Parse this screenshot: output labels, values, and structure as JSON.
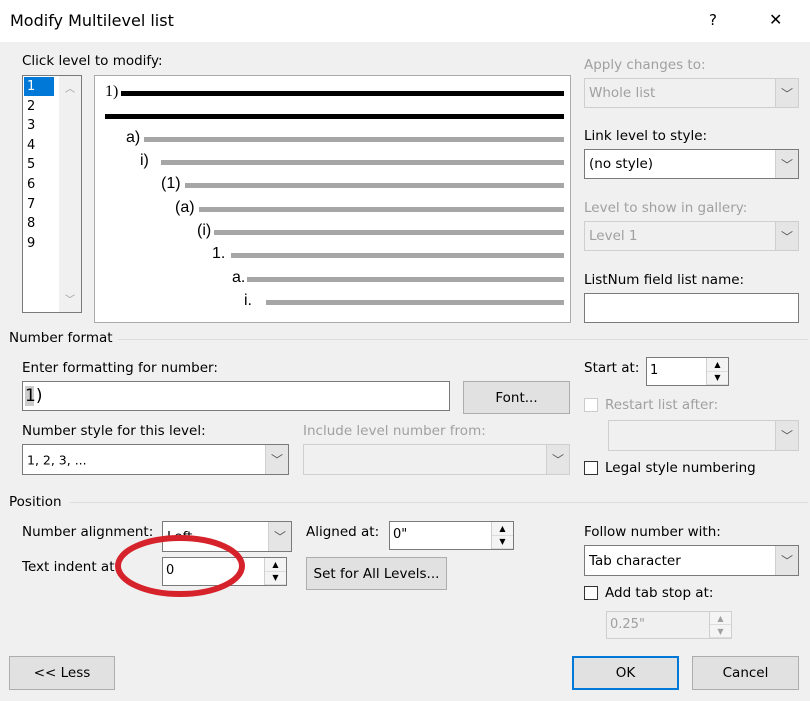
{
  "title": "Modify Multilevel list",
  "help": "?",
  "close": "✕",
  "levels_label": "Click level to modify:",
  "levels": [
    "1",
    "2",
    "3",
    "4",
    "5",
    "6",
    "7",
    "8",
    "9"
  ],
  "selected_level": "1",
  "preview": {
    "labels": [
      "1)",
      "a)",
      "i)",
      "(1)",
      "(a)",
      "(i)",
      "1.",
      "a.",
      "i."
    ]
  },
  "apply_changes_label": "Apply changes to:",
  "apply_changes_value": "Whole list",
  "link_level_label": "Link level to style:",
  "link_level_value": "(no style)",
  "gallery_level_label": "Level to show in gallery:",
  "gallery_level_value": "Level 1",
  "listnum_label": "ListNum field list name:",
  "listnum_value": "",
  "number_format": {
    "heading": "Number format",
    "enter_label": "Enter formatting for number:",
    "enter_value": "1)",
    "font_button": "Font...",
    "style_label": "Number style for this level:",
    "style_value": "1, 2, 3, ...",
    "include_label": "Include level number from:",
    "include_value": ""
  },
  "start_at_label": "Start at:",
  "start_at_value": "1",
  "restart_label": "Restart list after:",
  "restart_value": "",
  "legal_label": "Legal style numbering",
  "legal_checked": false,
  "position": {
    "heading": "Position",
    "alignment_label": "Number alignment:",
    "alignment_value": "Left",
    "aligned_at_label": "Aligned at:",
    "aligned_at_value": "0\"",
    "indent_label": "Text indent at:",
    "indent_value": "0",
    "set_all_button": "Set for All Levels..."
  },
  "follow_label": "Follow number with:",
  "follow_value": "Tab character",
  "add_tab_label": "Add tab stop at:",
  "add_tab_checked": false,
  "add_tab_value": "0.25\"",
  "less_button": "<< Less",
  "ok_button": "OK",
  "cancel_button": "Cancel",
  "annotation_color": "#d6222a"
}
